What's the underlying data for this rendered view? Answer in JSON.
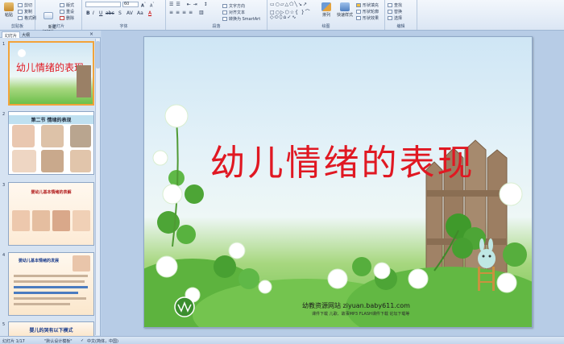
{
  "ribbon": {
    "groups": [
      {
        "label": "剪贴板"
      },
      {
        "label": "幻灯片"
      },
      {
        "label": "字体"
      },
      {
        "label": "段落"
      },
      {
        "label": "绘图"
      },
      {
        "label": "编辑"
      }
    ],
    "paste_label": "粘贴",
    "new_slide_label": "新建\n幻灯片",
    "cut_label": "剪切",
    "copy_label": "复制",
    "format_painter_label": "格式刷",
    "layout_label": "版式",
    "reset_label": "重设",
    "delete_label": "删除",
    "font_size_value": "60",
    "convert_smartart_label": "转换为 SmartArt",
    "arrange_label": "排列",
    "quick_styles_label": "快速样式",
    "shape_fill_label": "形状填充",
    "shape_outline_label": "形状轮廓",
    "shape_effects_label": "形状效果",
    "find_label": "查找",
    "replace_label": "替换",
    "select_label": "选择"
  },
  "panel": {
    "tab_slides": "幻灯片",
    "tab_outline": "大纲",
    "thumbnails": [
      {
        "num": "1",
        "title": "幼儿情绪的表现"
      },
      {
        "num": "2",
        "title": "第二节 情绪的表现"
      },
      {
        "num": "3",
        "title": "婴幼儿基本情绪的表解"
      },
      {
        "num": "4",
        "title": "婴幼儿基本情绪的发展"
      },
      {
        "num": "5",
        "title": "婴儿的哭有以下模式"
      }
    ]
  },
  "slide": {
    "title": "幼儿情绪的表现",
    "footer_site": "幼教资源网站  ziyuan.baby611.com",
    "footer_links": "课件下载  儿歌、故事MP3  FLASH课件下载  论坛下载等",
    "colors": {
      "title": "#e01822",
      "sky": "#cfe6f5",
      "grass": "#6cbf4a"
    }
  },
  "status": {
    "slide_count": "幻灯片 1/17",
    "theme": "\"默认设计模板\"",
    "language": "中文(简体，中国)"
  }
}
